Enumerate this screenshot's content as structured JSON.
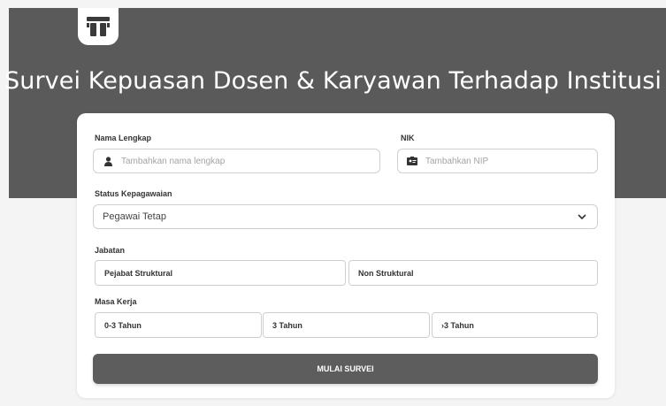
{
  "header": {
    "title": "Survei Kepuasan Dosen & Karyawan Terhadap Institusi"
  },
  "form": {
    "nama": {
      "label": "Nama Lengkap",
      "placeholder": "Tambahkan nama lengkap",
      "icon": "user-icon"
    },
    "nik": {
      "label": "NIK",
      "placeholder": "Tambahkan NIP",
      "icon": "id-card-icon"
    },
    "status": {
      "label": "Status Kepagawaian",
      "value": "Pegawai Tetap"
    },
    "jabatan": {
      "label": "Jabatan",
      "options": [
        "Pejabat Struktural",
        "Non Struktural"
      ]
    },
    "masa_kerja": {
      "label": "Masa Kerja",
      "options": [
        "0-3 Tahun",
        "3 Tahun",
        "›3 Tahun"
      ]
    },
    "submit_label": "MULAI SURVEI"
  },
  "colors": {
    "header_bg": "#5a5a5a",
    "button_bg": "#5d5d5d",
    "page_bg": "#f4f4f4"
  }
}
